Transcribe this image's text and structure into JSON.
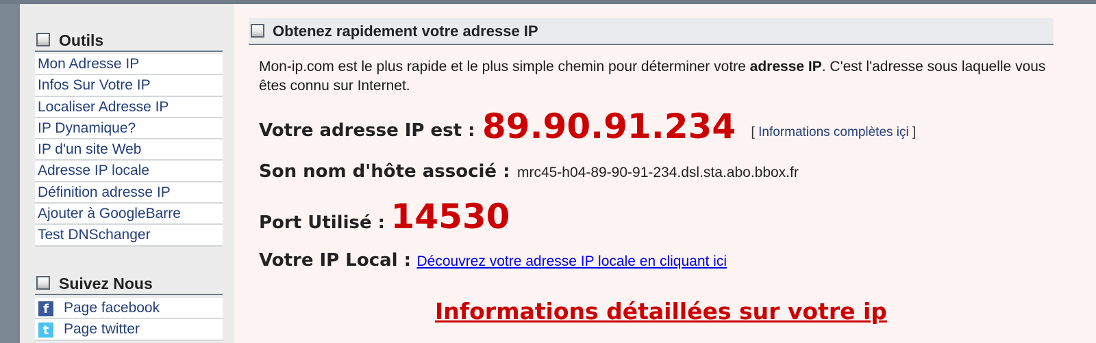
{
  "sidebar": {
    "tools_title": "Outils",
    "tools": [
      {
        "label": "Mon Adresse IP"
      },
      {
        "label": "Infos Sur Votre IP"
      },
      {
        "label": "Localiser Adresse IP"
      },
      {
        "label": "IP Dynamique?"
      },
      {
        "label": "IP d'un site Web"
      },
      {
        "label": "Adresse IP locale"
      },
      {
        "label": "Définition adresse IP"
      },
      {
        "label": "Ajouter à GoogleBarre"
      },
      {
        "label": "Test DNSchanger"
      }
    ],
    "follow_title": "Suivez Nous",
    "follow": [
      {
        "label": "Page facebook",
        "icon": "facebook-icon",
        "glyph": "f",
        "color": "#3b5998"
      },
      {
        "label": "Page twitter",
        "icon": "twitter-icon",
        "glyph": "t",
        "color": "#4cc2ef"
      }
    ]
  },
  "main": {
    "heading": "Obtenez rapidement votre adresse IP",
    "intro_before": "Mon-ip.com est le plus rapide et le plus simple chemin pour déterminer votre ",
    "intro_bold": "adresse IP",
    "intro_after": ". C'est l'adresse sous laquelle vous êtes connu sur Internet.",
    "ip_label": "Votre adresse IP est :",
    "ip_value": "89.90.91.234",
    "full_info_open": "[",
    "full_info_link": "Informations complètes içi",
    "full_info_close": "]",
    "host_label": "Son nom d'hôte associé :",
    "host_value": "mrc45-h04-89-90-91-234.dsl.sta.abo.bbox.fr",
    "port_label": "Port Utilisé :",
    "port_value": "14530",
    "local_label": "Votre IP Local :",
    "local_link": "Découvrez votre adresse IP locale en cliquant ici",
    "details_link": "Informations détaillées sur votre ip"
  },
  "colors": {
    "accent_red": "#cc0000",
    "link_blue": "#233f7a",
    "frame_gray": "#7b8793"
  }
}
